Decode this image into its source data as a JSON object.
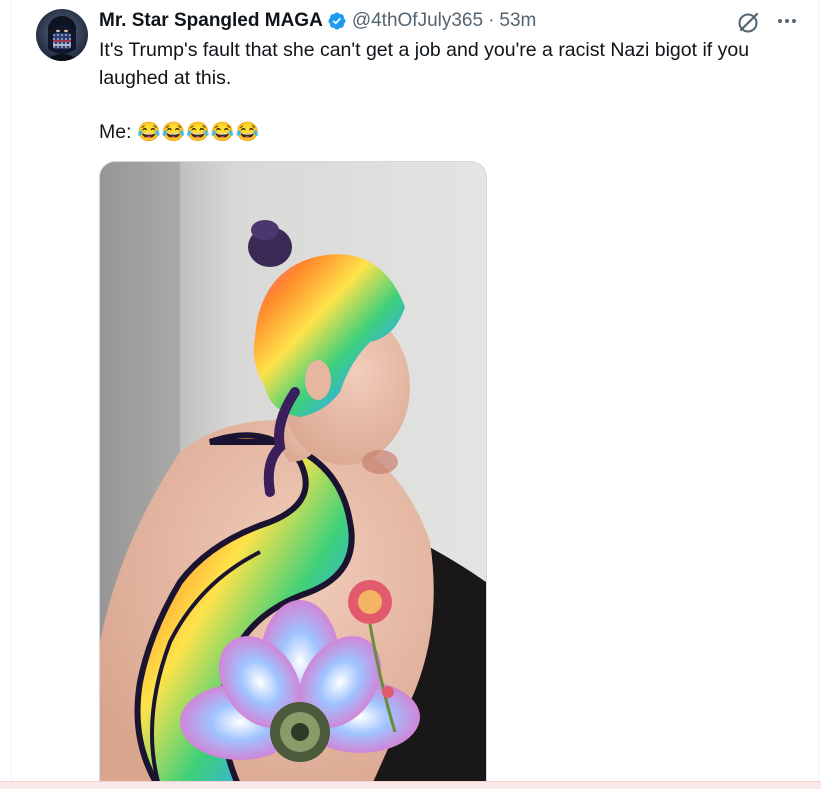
{
  "tweet": {
    "author_name": "Mr. Star Spangled MAGA",
    "author_handle": "@4thOfJuly365",
    "separator": "·",
    "timestamp": "53m",
    "text_line1": "It's Trump's fault that she can't get a job and you're a racist Nazi bigot if you laughed at this.",
    "text_line2_label": "Me: ",
    "text_line2_emoji": "😂😂😂😂😂",
    "verified": true
  },
  "colors": {
    "text_primary": "#0f1419",
    "text_secondary": "#536471",
    "verified_blue": "#1d9bf0"
  },
  "icons": {
    "verified": "verified-badge-icon",
    "grok": "grok-icon",
    "more": "more-dots-icon"
  }
}
